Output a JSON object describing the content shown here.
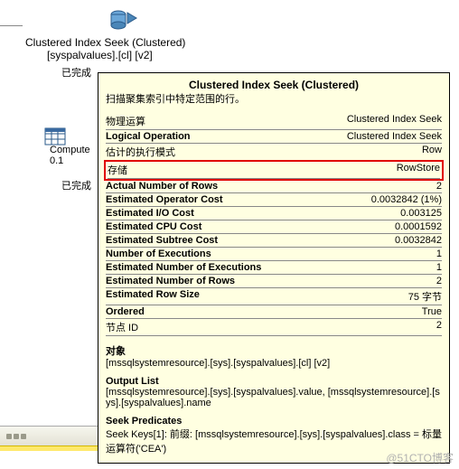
{
  "plan_node": {
    "title": "Clustered Index Seek (Clustered)",
    "subtitle": "[syspalvalues].[cl] [v2]",
    "done": "已完成"
  },
  "compute_node": {
    "title": "Compute",
    "cost": "0.1",
    "done": "已完成"
  },
  "tooltip": {
    "title": "Clustered Index Seek (Clustered)",
    "desc": "扫描聚集索引中特定范围的行。",
    "rows": [
      {
        "label": "物理运算",
        "value": "Clustered Index Seek",
        "bold": false
      },
      {
        "label": "Logical Operation",
        "value": "Clustered Index Seek",
        "bold": true
      },
      {
        "label": "估计的执行模式",
        "value": "Row",
        "bold": false
      },
      {
        "label": "存储",
        "value": "RowStore",
        "bold": false,
        "highlight": true
      },
      {
        "label": "Actual Number of Rows",
        "value": "2",
        "bold": true
      },
      {
        "label": "Estimated Operator Cost",
        "value": "0.0032842 (1%)",
        "bold": true
      },
      {
        "label": "Estimated I/O Cost",
        "value": "0.003125",
        "bold": true
      },
      {
        "label": "Estimated CPU Cost",
        "value": "0.0001592",
        "bold": true
      },
      {
        "label": "Estimated Subtree Cost",
        "value": "0.0032842",
        "bold": true
      },
      {
        "label": "Number of Executions",
        "value": "1",
        "bold": true
      },
      {
        "label": "Estimated Number of Executions",
        "value": "1",
        "bold": true
      },
      {
        "label": "Estimated Number of Rows",
        "value": "2",
        "bold": true
      },
      {
        "label": "Estimated Row Size",
        "value": "75 字节",
        "bold": true
      },
      {
        "label": "Ordered",
        "value": "True",
        "bold": true
      },
      {
        "label": "节点 ID",
        "value": "2",
        "bold": false
      }
    ],
    "object_head": "对象",
    "object_body": "[mssqlsystemresource].[sys].[syspalvalues].[cl] [v2]",
    "output_head": "Output List",
    "output_body": "[mssqlsystemresource].[sys].[syspalvalues].value, [mssqlsystemresource].[sys].[syspalvalues].name",
    "seek_head": "Seek Predicates",
    "seek_body": "Seek Keys[1]: 前缀: [mssqlsystemresource].[sys].[syspalvalues].class = 标量运算符('CEA')"
  },
  "watermark": "@51CTO博客"
}
